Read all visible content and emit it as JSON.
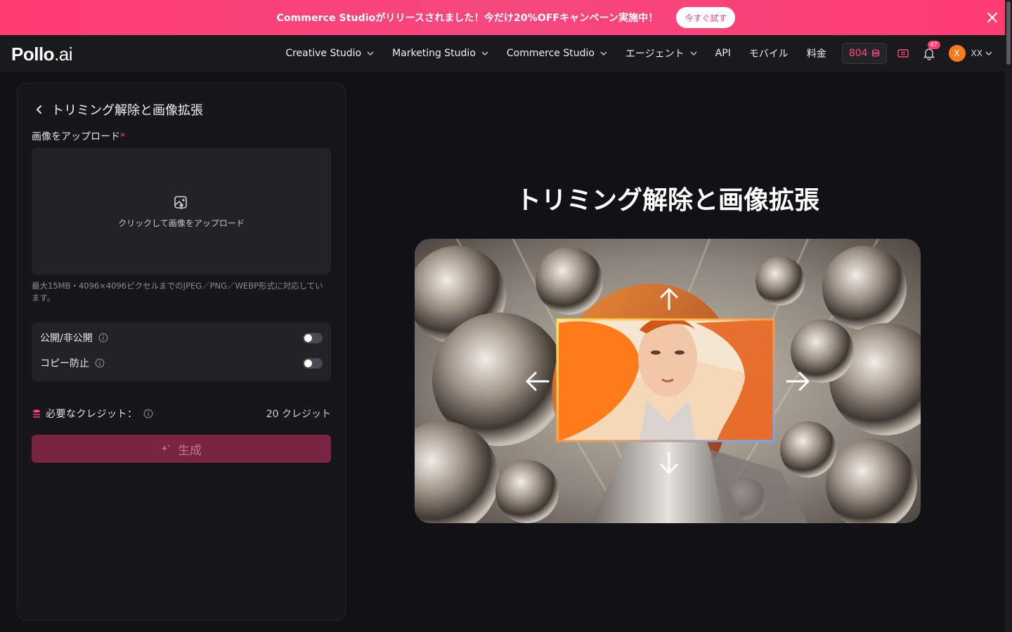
{
  "promo": {
    "text": "Commerce Studioがリリースされました！今だけ20%OFFキャンペーン実施中！",
    "cta": "今すぐ試す",
    "close_icon": "close-icon"
  },
  "logo": {
    "main": "Pollo",
    "suffix": ".ai"
  },
  "nav": {
    "items": [
      {
        "label": "Creative Studio",
        "dropdown": true
      },
      {
        "label": "Marketing Studio",
        "dropdown": true
      },
      {
        "label": "Commerce Studio",
        "dropdown": true
      },
      {
        "label": "エージェント",
        "dropdown": true
      },
      {
        "label": "API",
        "dropdown": false
      },
      {
        "label": "モバイル",
        "dropdown": false
      },
      {
        "label": "料金",
        "dropdown": false
      }
    ],
    "credits": "804",
    "notification_count": "47",
    "avatar_initial": "X",
    "user_name": "XX",
    "accent": "#ff3d71"
  },
  "panel": {
    "title": "トリミング解除と画像拡張",
    "upload_label": "画像をアップロード",
    "required_mark": "*",
    "dropzone_text": "クリックして画像をアップロード",
    "hint": "最大15MB・4096×4096ピクセルまでのJPEG／PNG／WEBP形式に対応しています。",
    "toggles": [
      {
        "label": "公開/非公開",
        "on": false
      },
      {
        "label": "コピー防止",
        "on": false
      }
    ],
    "credits_label": "必要なクレジット：",
    "credits_value": "20 クレジット",
    "generate_label": "生成"
  },
  "hero": {
    "title": "トリミング解除と画像拡張"
  }
}
